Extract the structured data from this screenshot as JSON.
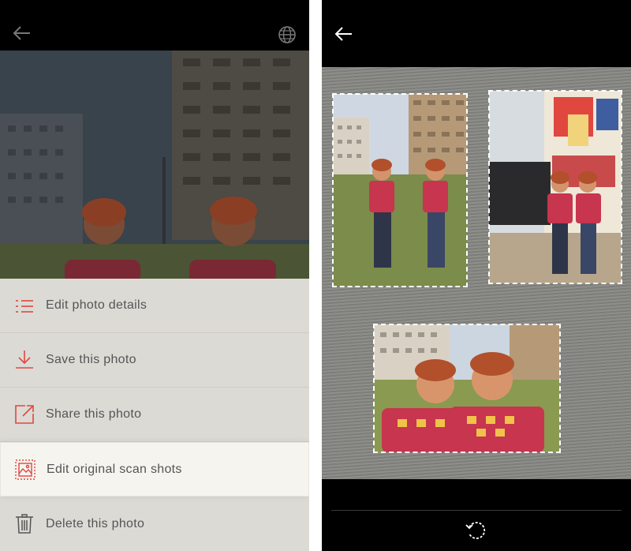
{
  "left_panel": {
    "menu": [
      {
        "label": "Edit photo details",
        "icon": "list-icon"
      },
      {
        "label": "Save this photo",
        "icon": "download-icon"
      },
      {
        "label": "Share this photo",
        "icon": "share-icon"
      },
      {
        "label": "Edit original scan shots",
        "icon": "image-icon"
      },
      {
        "label": "Delete this photo",
        "icon": "trash-icon"
      }
    ]
  },
  "colors": {
    "accent": "#e0473f",
    "menu_background": "#dcdad5",
    "active_row": "#f5f4ef",
    "label_text": "#555555"
  }
}
